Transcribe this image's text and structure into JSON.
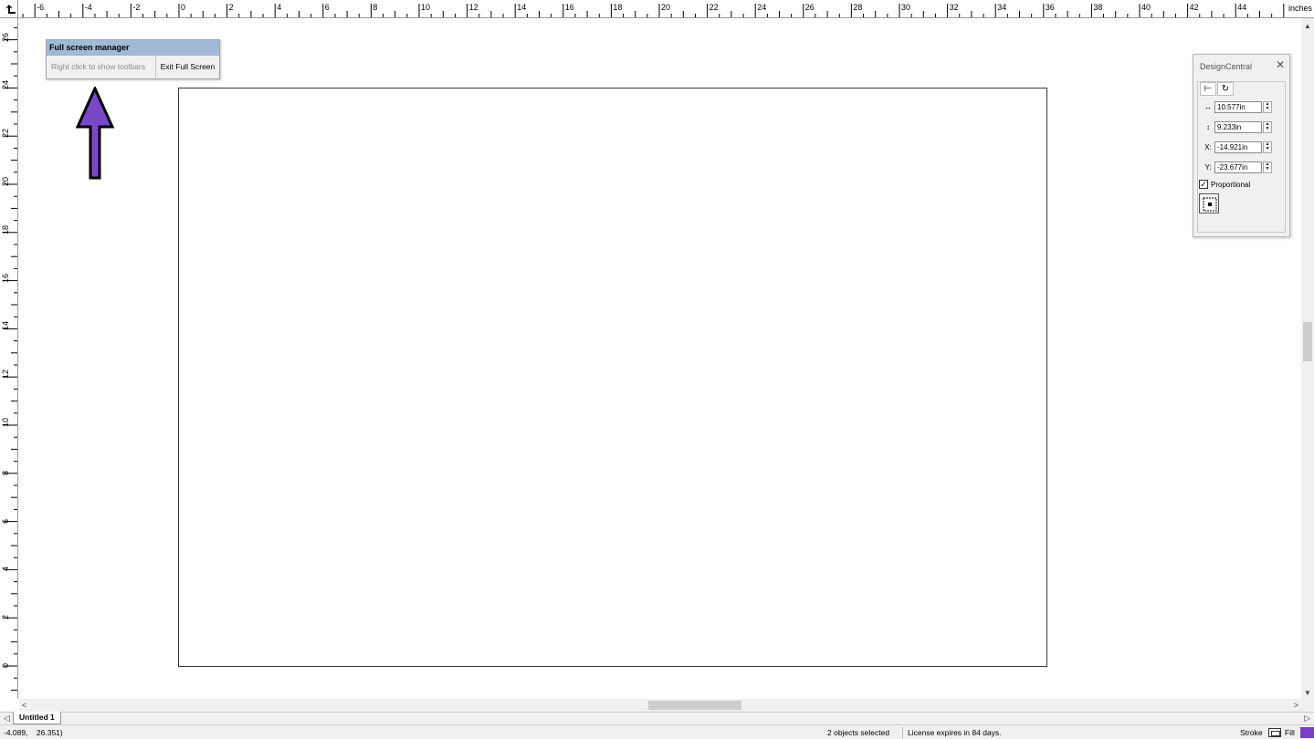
{
  "ruler": {
    "units": "inches",
    "top_labels": [
      "-6",
      "-4",
      "-2",
      "0",
      "2",
      "4",
      "6",
      "8",
      "10",
      "12",
      "14",
      "16",
      "18",
      "20",
      "22",
      "24",
      "26",
      "28",
      "30",
      "32",
      "34",
      "36",
      "38",
      "40",
      "42",
      "44"
    ],
    "left_labels": [
      "26",
      "24",
      "22",
      "20",
      "18",
      "16",
      "14",
      "12",
      "10",
      "8",
      "6",
      "4",
      "2",
      "0"
    ]
  },
  "full_screen_manager": {
    "title": "Full screen manager",
    "hint": "Right click to show toolbars",
    "exit_label": "Exit Full Screen"
  },
  "arrow": {
    "color": "#7b47c9",
    "outline": "#000000"
  },
  "design_central": {
    "title": "DesignCentral",
    "close_icon": "close-icon",
    "tabs": [
      {
        "icon": "size-position-icon",
        "glyph": "⊢"
      },
      {
        "icon": "rotate-icon",
        "glyph": "↻"
      }
    ],
    "fields": [
      {
        "name": "width",
        "label_glyph": "↔",
        "value": "10.577in"
      },
      {
        "name": "height",
        "label_glyph": "↕",
        "value": "9.233in"
      },
      {
        "name": "x",
        "label_glyph": "X:",
        "value": "-14.921in"
      },
      {
        "name": "y",
        "label_glyph": "Y:",
        "value": "-23.677in"
      }
    ],
    "proportional": {
      "label": "Proportional",
      "checked": true
    }
  },
  "tabs": [
    {
      "label": "Untitled 1",
      "active": true
    }
  ],
  "status": {
    "coords": "-4.089,    26.351)",
    "selection": "2 objects selected",
    "license": "License expires in 84 days.",
    "stroke_label": "Stroke",
    "fill_label": "Fill",
    "fill_color": "#7b3fc4"
  }
}
